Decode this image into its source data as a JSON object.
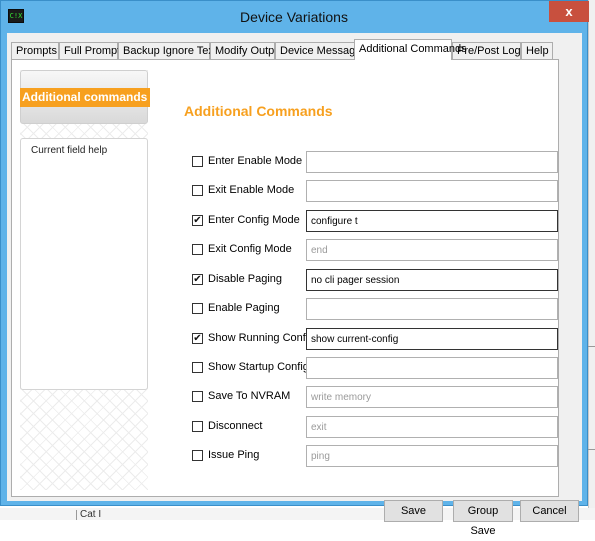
{
  "window": {
    "title": "Device Variations",
    "app_icon_text": "C!X",
    "close_label": "x"
  },
  "tabs": [
    {
      "label": "Prompts",
      "active": false
    },
    {
      "label": "Full Prompts",
      "active": false
    },
    {
      "label": "Backup Ignore Text",
      "active": false
    },
    {
      "label": "Modify Output",
      "active": false
    },
    {
      "label": "Device Messages",
      "active": false
    },
    {
      "label": "Additional Commands",
      "active": true
    },
    {
      "label": "Pre/Post Login",
      "active": false
    },
    {
      "label": "Help",
      "active": false
    }
  ],
  "sidebar": {
    "badge_label": "Additional commands",
    "help_title": "Current field help"
  },
  "section_title": "Additional Commands",
  "rows": [
    {
      "label": "Enter Enable Mode",
      "checked": false,
      "value": "",
      "placeholder": ""
    },
    {
      "label": "Exit Enable Mode",
      "checked": false,
      "value": "",
      "placeholder": ""
    },
    {
      "label": "Enter Config Mode",
      "checked": true,
      "value": "configure t",
      "placeholder": ""
    },
    {
      "label": "Exit Config Mode",
      "checked": false,
      "value": "",
      "placeholder": "end"
    },
    {
      "label": "Disable Paging",
      "checked": true,
      "value": "no cli pager session",
      "placeholder": ""
    },
    {
      "label": "Enable Paging",
      "checked": false,
      "value": "",
      "placeholder": ""
    },
    {
      "label": "Show Running Config",
      "checked": true,
      "value": "show current-config",
      "placeholder": ""
    },
    {
      "label": "Show Startup Config",
      "checked": false,
      "value": "",
      "placeholder": ""
    },
    {
      "label": "Save To NVRAM",
      "checked": false,
      "value": "",
      "placeholder": "write memory"
    },
    {
      "label": "Disconnect",
      "checked": false,
      "value": "",
      "placeholder": "exit"
    },
    {
      "label": "Issue Ping",
      "checked": false,
      "value": "",
      "placeholder": "ping"
    }
  ],
  "buttons": {
    "save": "Save",
    "group_save": "Group Save",
    "cancel": "Cancel"
  },
  "background": {
    "cell_text": "Cat I"
  },
  "colors": {
    "titlebar": "#5fb3e9",
    "accent_orange": "#f7a01f",
    "close_red": "#c8503e"
  }
}
